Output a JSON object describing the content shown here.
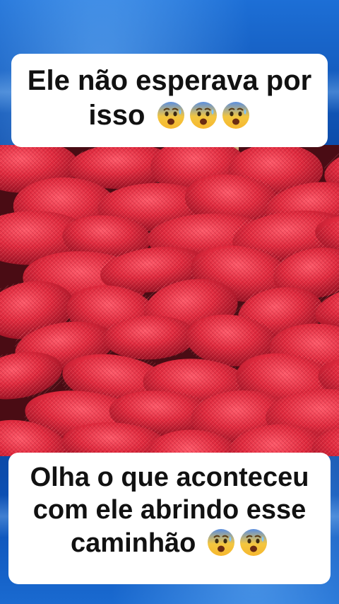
{
  "captions": {
    "top_line1": "Ele não esperava por",
    "top_line2": "isso",
    "bottom_line1": "Olha o que aconteceu",
    "bottom_line2": "com ele abrindo esse",
    "bottom_line3": "caminhão"
  },
  "emoji": {
    "name": "anxious-face-with-sweat-icon",
    "top_count": 3,
    "bottom_count": 2
  },
  "colors": {
    "background": "#0c4aa8",
    "caption_bg": "#ffffff",
    "caption_text": "#111111",
    "sack_red": "#d9233a"
  }
}
